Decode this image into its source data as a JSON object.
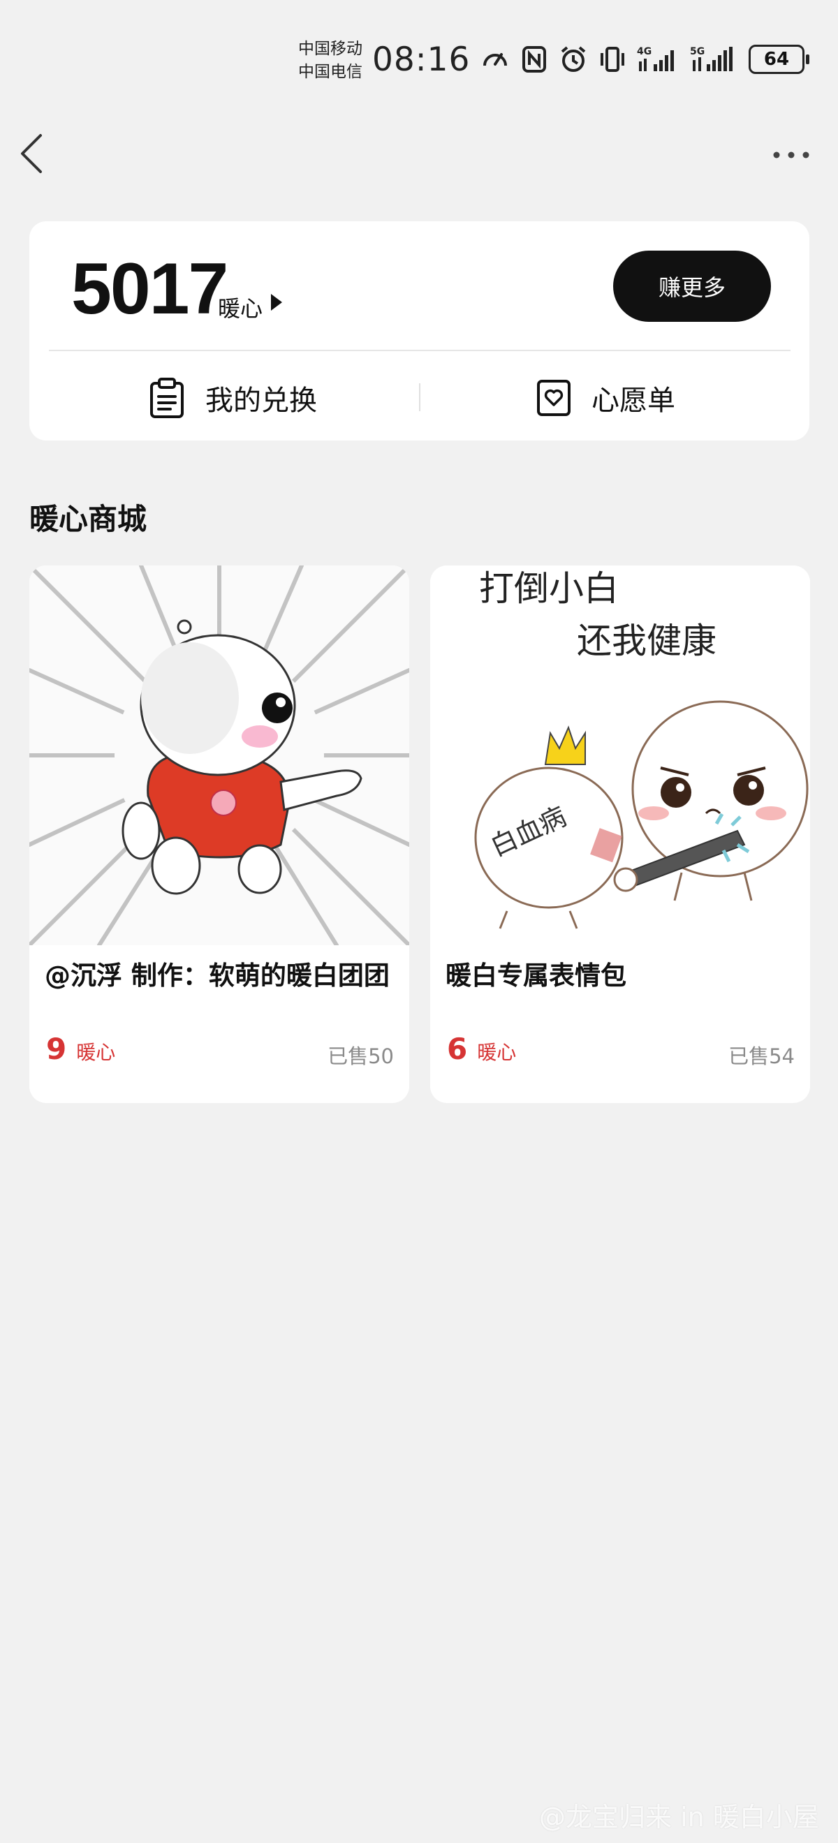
{
  "status_bar": {
    "carrier1": "中国移动",
    "carrier2": "中国电信",
    "time": "08:16",
    "battery": "64",
    "icons": [
      "speed-icon",
      "nfc-icon",
      "alarm-icon",
      "vibrate-icon",
      "signal-4g-icon",
      "signal-5g-icon"
    ]
  },
  "header": {
    "back_icon": "back-chevron-icon",
    "more_icon": "more-dots-icon"
  },
  "balance_card": {
    "amount": "5017",
    "unit": "暖心",
    "earn_button": "赚更多",
    "my_exchange": "我的兑换",
    "wishlist": "心愿单"
  },
  "section": {
    "title": "暖心商城"
  },
  "products": [
    {
      "title": "@沉浮 制作：软萌的暖白团团",
      "price": "9",
      "price_unit": "暖心",
      "sold": "已售50"
    },
    {
      "title": "暖白专属表情包",
      "price": "6",
      "price_unit": "暖心",
      "sold": "已售54",
      "image_text_1": "打倒小白",
      "image_text_2": "还我健康",
      "image_text_3": "白血病"
    }
  ],
  "watermark": "@龙宝归来 in 暖白小屋",
  "colors": {
    "accent_red": "#d63434",
    "button_black": "#111111",
    "background": "#f1f1f1"
  }
}
